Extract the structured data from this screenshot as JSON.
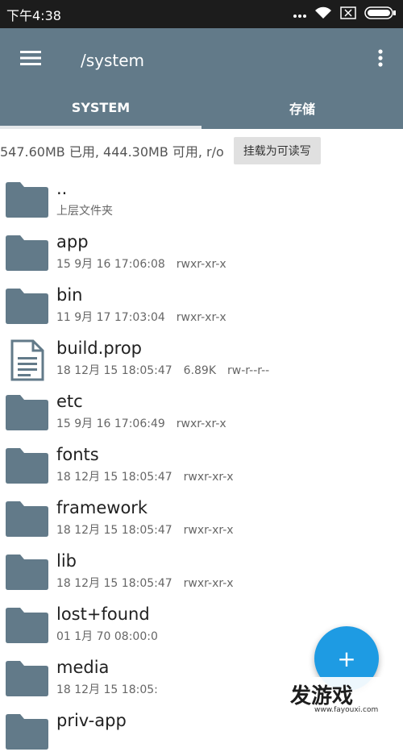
{
  "status_bar": {
    "time": "下午4:38",
    "icons": [
      "dots-icon",
      "wifi-icon",
      "sim-off-icon",
      "battery-icon"
    ]
  },
  "app_bar": {
    "path": "/system",
    "menu_icon": "hamburger-icon",
    "more_icon": "more-vert-icon",
    "color": "#627a89"
  },
  "tabs": [
    {
      "label": "SYSTEM",
      "active": true
    },
    {
      "label": "存储",
      "active": false
    }
  ],
  "info": {
    "usage": "547.60MB 已用, 444.30MB 可用, r/o",
    "mount_button": "挂载为可读写"
  },
  "files": [
    {
      "name": "..",
      "type": "folder",
      "date": "上层文件夹",
      "size": "",
      "perm": ""
    },
    {
      "name": "app",
      "type": "folder",
      "date": "15 9月 16 17:06:08",
      "size": "",
      "perm": "rwxr-xr-x"
    },
    {
      "name": "bin",
      "type": "folder",
      "date": "11 9月 17 17:03:04",
      "size": "",
      "perm": "rwxr-xr-x"
    },
    {
      "name": "build.prop",
      "type": "file",
      "date": "18 12月 15 18:05:47",
      "size": "6.89K",
      "perm": "rw-r--r--"
    },
    {
      "name": "etc",
      "type": "folder",
      "date": "15 9月 16 17:06:49",
      "size": "",
      "perm": "rwxr-xr-x"
    },
    {
      "name": "fonts",
      "type": "folder",
      "date": "18 12月 15 18:05:47",
      "size": "",
      "perm": "rwxr-xr-x"
    },
    {
      "name": "framework",
      "type": "folder",
      "date": "18 12月 15 18:05:47",
      "size": "",
      "perm": "rwxr-xr-x"
    },
    {
      "name": "lib",
      "type": "folder",
      "date": "18 12月 15 18:05:47",
      "size": "",
      "perm": "rwxr-xr-x"
    },
    {
      "name": "lost+found",
      "type": "folder",
      "date": "01 1月 70 08:00:0",
      "size": "",
      "perm": ""
    },
    {
      "name": "media",
      "type": "folder",
      "date": "18 12月 15 18:05:",
      "size": "",
      "perm": ""
    },
    {
      "name": "priv-app",
      "type": "folder",
      "date": "",
      "size": "",
      "perm": ""
    }
  ],
  "fab": {
    "label": "+",
    "color": "#1e9be3"
  },
  "watermark": {
    "title": "发游戏",
    "url": "www.fayouxi.com"
  }
}
